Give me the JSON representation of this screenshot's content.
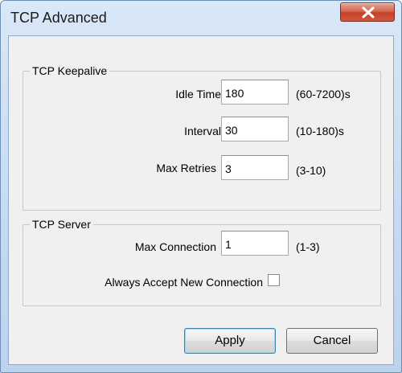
{
  "window": {
    "title": "TCP Advanced",
    "close_icon": "close-x-icon",
    "close_color": "#c94a32"
  },
  "keepalive": {
    "legend": "TCP Keepalive",
    "idle_time": {
      "label": "Idle Time",
      "value": "180",
      "range": "(60-7200)s"
    },
    "interval": {
      "label": "Interval",
      "value": "30",
      "range": "(10-180)s"
    },
    "max_retries": {
      "label": "Max Retries",
      "value": "3",
      "range": "(3-10)"
    }
  },
  "server": {
    "legend": "TCP Server",
    "max_connection": {
      "label": "Max Connection",
      "value": "1",
      "range": "(1-3)"
    },
    "always_accept": {
      "label": "Always Accept New Connection",
      "checked": false
    }
  },
  "buttons": {
    "apply": "Apply",
    "cancel": "Cancel"
  }
}
